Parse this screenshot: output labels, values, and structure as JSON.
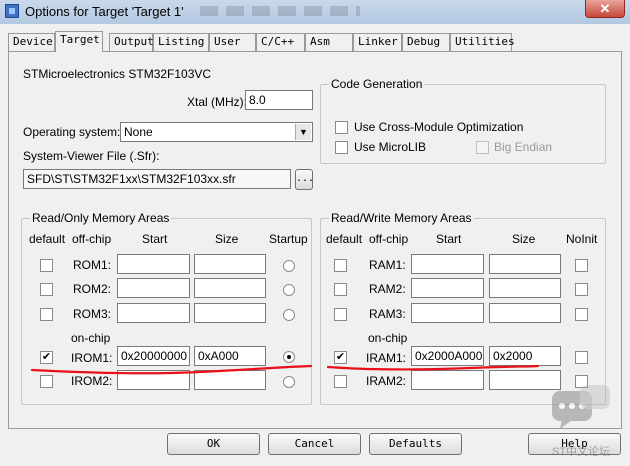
{
  "window": {
    "title": "Options for Target 'Target 1'",
    "close_label": "✕"
  },
  "tabs": [
    "Device",
    "Target",
    "Output",
    "Listing",
    "User",
    "C/C++",
    "Asm",
    "Linker",
    "Debug",
    "Utilities"
  ],
  "active_tab": "Target",
  "target": {
    "device_name": "STMicroelectronics STM32F103VC",
    "xtal_label": "Xtal (MHz):",
    "xtal_value": "8.0",
    "os_label": "Operating system:",
    "os_value": "None",
    "sfr_label": "System-Viewer File (.Sfr):",
    "sfr_value": "SFD\\ST\\STM32F1xx\\STM32F103xx.sfr",
    "browse_label": "..."
  },
  "code_generation": {
    "legend": "Code Generation",
    "cross_module_label": "Use Cross-Module Optimization",
    "cross_module_checked": false,
    "microlib_label": "Use MicroLIB",
    "microlib_checked": false,
    "big_endian_label": "Big Endian",
    "big_endian_checked": false
  },
  "rom": {
    "legend": "Read/Only Memory Areas",
    "headers": {
      "default": "default",
      "offchip": "off-chip",
      "start": "Start",
      "size": "Size",
      "flag": "Startup"
    },
    "onchip_label": "on-chip",
    "rows": [
      {
        "name": "ROM1:",
        "checked": false,
        "start": "",
        "size": "",
        "selected": false
      },
      {
        "name": "ROM2:",
        "checked": false,
        "start": "",
        "size": "",
        "selected": false
      },
      {
        "name": "ROM3:",
        "checked": false,
        "start": "",
        "size": "",
        "selected": false
      },
      {
        "name": "IROM1:",
        "checked": true,
        "start": "0x20000000",
        "size": "0xA000",
        "selected": true
      },
      {
        "name": "IROM2:",
        "checked": false,
        "start": "",
        "size": "",
        "selected": false
      }
    ]
  },
  "ram": {
    "legend": "Read/Write Memory Areas",
    "headers": {
      "default": "default",
      "offchip": "off-chip",
      "start": "Start",
      "size": "Size",
      "flag": "NoInit"
    },
    "onchip_label": "on-chip",
    "rows": [
      {
        "name": "RAM1:",
        "checked": false,
        "start": "",
        "size": "",
        "noinit": false
      },
      {
        "name": "RAM2:",
        "checked": false,
        "start": "",
        "size": "",
        "noinit": false
      },
      {
        "name": "RAM3:",
        "checked": false,
        "start": "",
        "size": "",
        "noinit": false
      },
      {
        "name": "IRAM1:",
        "checked": true,
        "start": "0x2000A000",
        "size": "0x2000",
        "noinit": false
      },
      {
        "name": "IRAM2:",
        "checked": false,
        "start": "",
        "size": "",
        "noinit": false
      }
    ]
  },
  "buttons": {
    "ok": "OK",
    "cancel": "Cancel",
    "defaults": "Defaults",
    "help": "Help"
  },
  "watermark_text": "ST中文论坛",
  "annotation_color": "#e8101a"
}
